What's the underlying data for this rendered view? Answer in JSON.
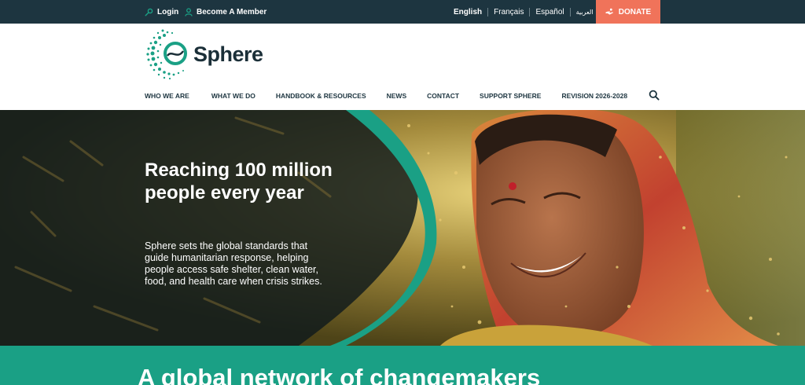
{
  "topbar": {
    "login_label": "Login",
    "member_label": "Become A Member",
    "languages": [
      "English",
      "Français",
      "Español",
      "العربية"
    ],
    "active_language": "English",
    "donate_label": "DONATE"
  },
  "header": {
    "logo_text": "Sphere",
    "nav": [
      "WHO WE ARE",
      "WHAT WE DO",
      "HANDBOOK & RESOURCES",
      "NEWS",
      "CONTACT",
      "SUPPORT SPHERE",
      "REVISION 2026-2028"
    ],
    "search_icon": "search-icon"
  },
  "hero": {
    "title": "Reaching 100 million people every year",
    "text": "Sphere sets the global standards that guide humanitarian response, helping people access safe shelter, clean water, food, and health care when crisis strikes."
  },
  "band": {
    "title": "A global network of changemakers"
  },
  "colors": {
    "topbar": "#1d3540",
    "donate": "#f0735a",
    "accent": "#1aa085",
    "dark_text": "#1b2f38"
  }
}
